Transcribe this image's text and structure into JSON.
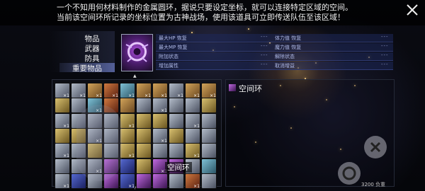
{
  "description": {
    "line1": "一个不知用何材料制作的金属圆环，据说只要设定坐标，就可以连接特定区域的空间。",
    "line2": "当前该空间环所记录的坐标位置为古神战场，使用该道具可立即传送队伍至该区域！"
  },
  "categories": [
    {
      "label": "物品",
      "selected": false
    },
    {
      "label": "武器",
      "selected": false
    },
    {
      "label": "防具",
      "selected": false
    },
    {
      "label": "重要物品",
      "selected": true
    }
  ],
  "stats": {
    "left": [
      "最大HP 恢复",
      "最大MP 恢复",
      "附加状态",
      "增加属性"
    ],
    "right": [
      "体力值 恢复",
      "魔力值 恢复",
      "解除状态",
      "取消增益"
    ],
    "placeholder": "---"
  },
  "inventory": {
    "count_label": "×1",
    "tooltip": "空间环"
  },
  "detail": {
    "item_name": "空间环"
  },
  "weight": {
    "current": "3200",
    "label": "负重"
  },
  "icons": {
    "close": "close-icon",
    "action": "circle-button-icon",
    "confirm": "cross-button-icon"
  },
  "colors": {
    "accent_selected": "#8ca0ff",
    "item_purple": "#b04fe0",
    "stats_bg": "#1e285a"
  }
}
